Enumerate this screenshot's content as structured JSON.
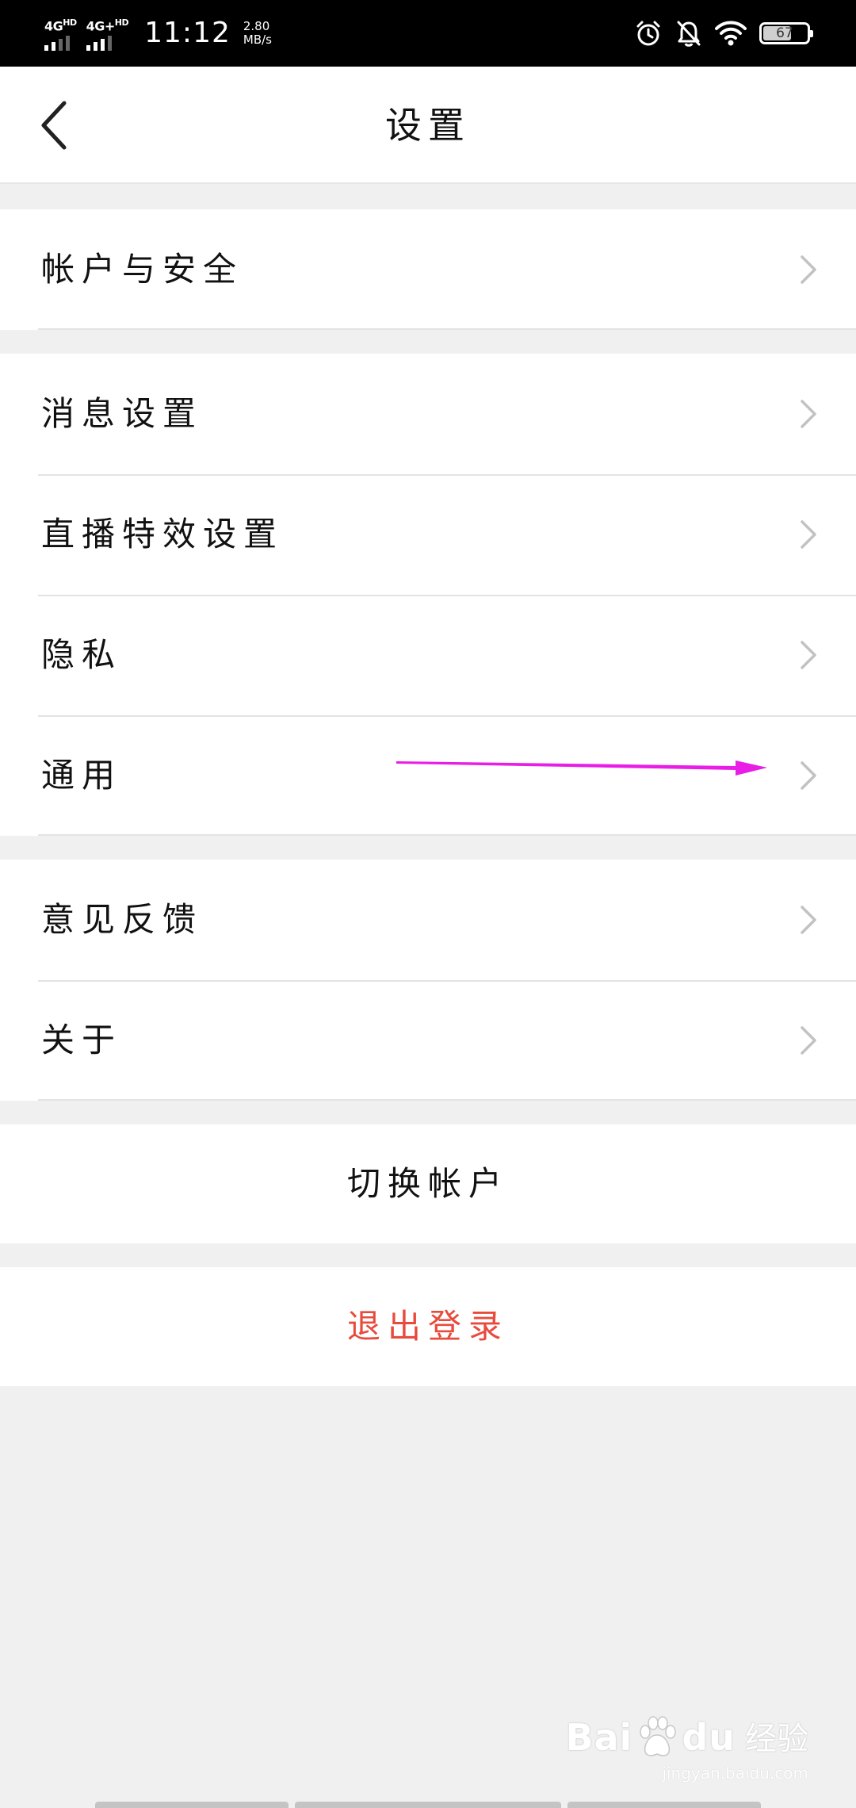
{
  "status_bar": {
    "network_1": "4G",
    "network_1_suffix": "HD",
    "network_2": "4G+",
    "network_2_suffix": "HD",
    "time": "11:12",
    "speed_value": "2.80",
    "speed_unit": "MB/s",
    "battery_level": "67",
    "battery_fraction": 0.67,
    "icons": [
      "alarm-icon",
      "bell-muted-icon",
      "wifi-icon",
      "battery-icon"
    ]
  },
  "header": {
    "title": "设置",
    "back_icon": "chevron-left-icon"
  },
  "groups": [
    {
      "items": [
        {
          "label": "帐户与安全"
        }
      ]
    },
    {
      "items": [
        {
          "label": "消息设置"
        },
        {
          "label": "直播特效设置"
        },
        {
          "label": "隐私"
        },
        {
          "label": "通用"
        }
      ]
    },
    {
      "items": [
        {
          "label": "意见反馈"
        },
        {
          "label": "关于"
        }
      ]
    }
  ],
  "actions": {
    "switch_account": "切换帐户",
    "logout": "退出登录"
  },
  "watermark": {
    "brand": "Bai",
    "brand_cn": "经验",
    "url": "jingyan.baidu.com"
  },
  "colors": {
    "logout_text": "#e84b3c",
    "annotation_arrow": "#e81ee6",
    "chevron": "#c2c2c2",
    "page_background": "#f0f0f0"
  }
}
